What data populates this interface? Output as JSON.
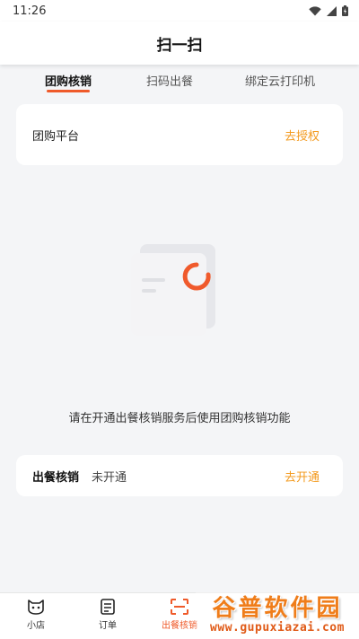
{
  "status_bar": {
    "time": "11:26"
  },
  "header": {
    "title": "扫一扫"
  },
  "tabs": [
    {
      "label": "团购核销",
      "active": true
    },
    {
      "label": "扫码出餐",
      "active": false
    },
    {
      "label": "绑定云打印机",
      "active": false
    }
  ],
  "platform_card": {
    "label": "团购平台",
    "action": "去授权"
  },
  "empty_state": {
    "message": "请在开通出餐核销服务后使用团购核销功能"
  },
  "meal_card": {
    "title": "出餐核销",
    "status": "未开通",
    "action": "去开通"
  },
  "bottom_nav": [
    {
      "label": "小店",
      "icon": "cat-face-icon",
      "active": false
    },
    {
      "label": "订单",
      "icon": "order-list-icon",
      "active": false
    },
    {
      "label": "出餐核销",
      "icon": "scan-frame-icon",
      "active": true
    }
  ],
  "watermark": {
    "title": "谷普软件园",
    "url": "www.gupuxiazai.com"
  },
  "colors": {
    "accent": "#ef5a2a",
    "link": "#f39a1e",
    "background": "#f4f5f7"
  }
}
